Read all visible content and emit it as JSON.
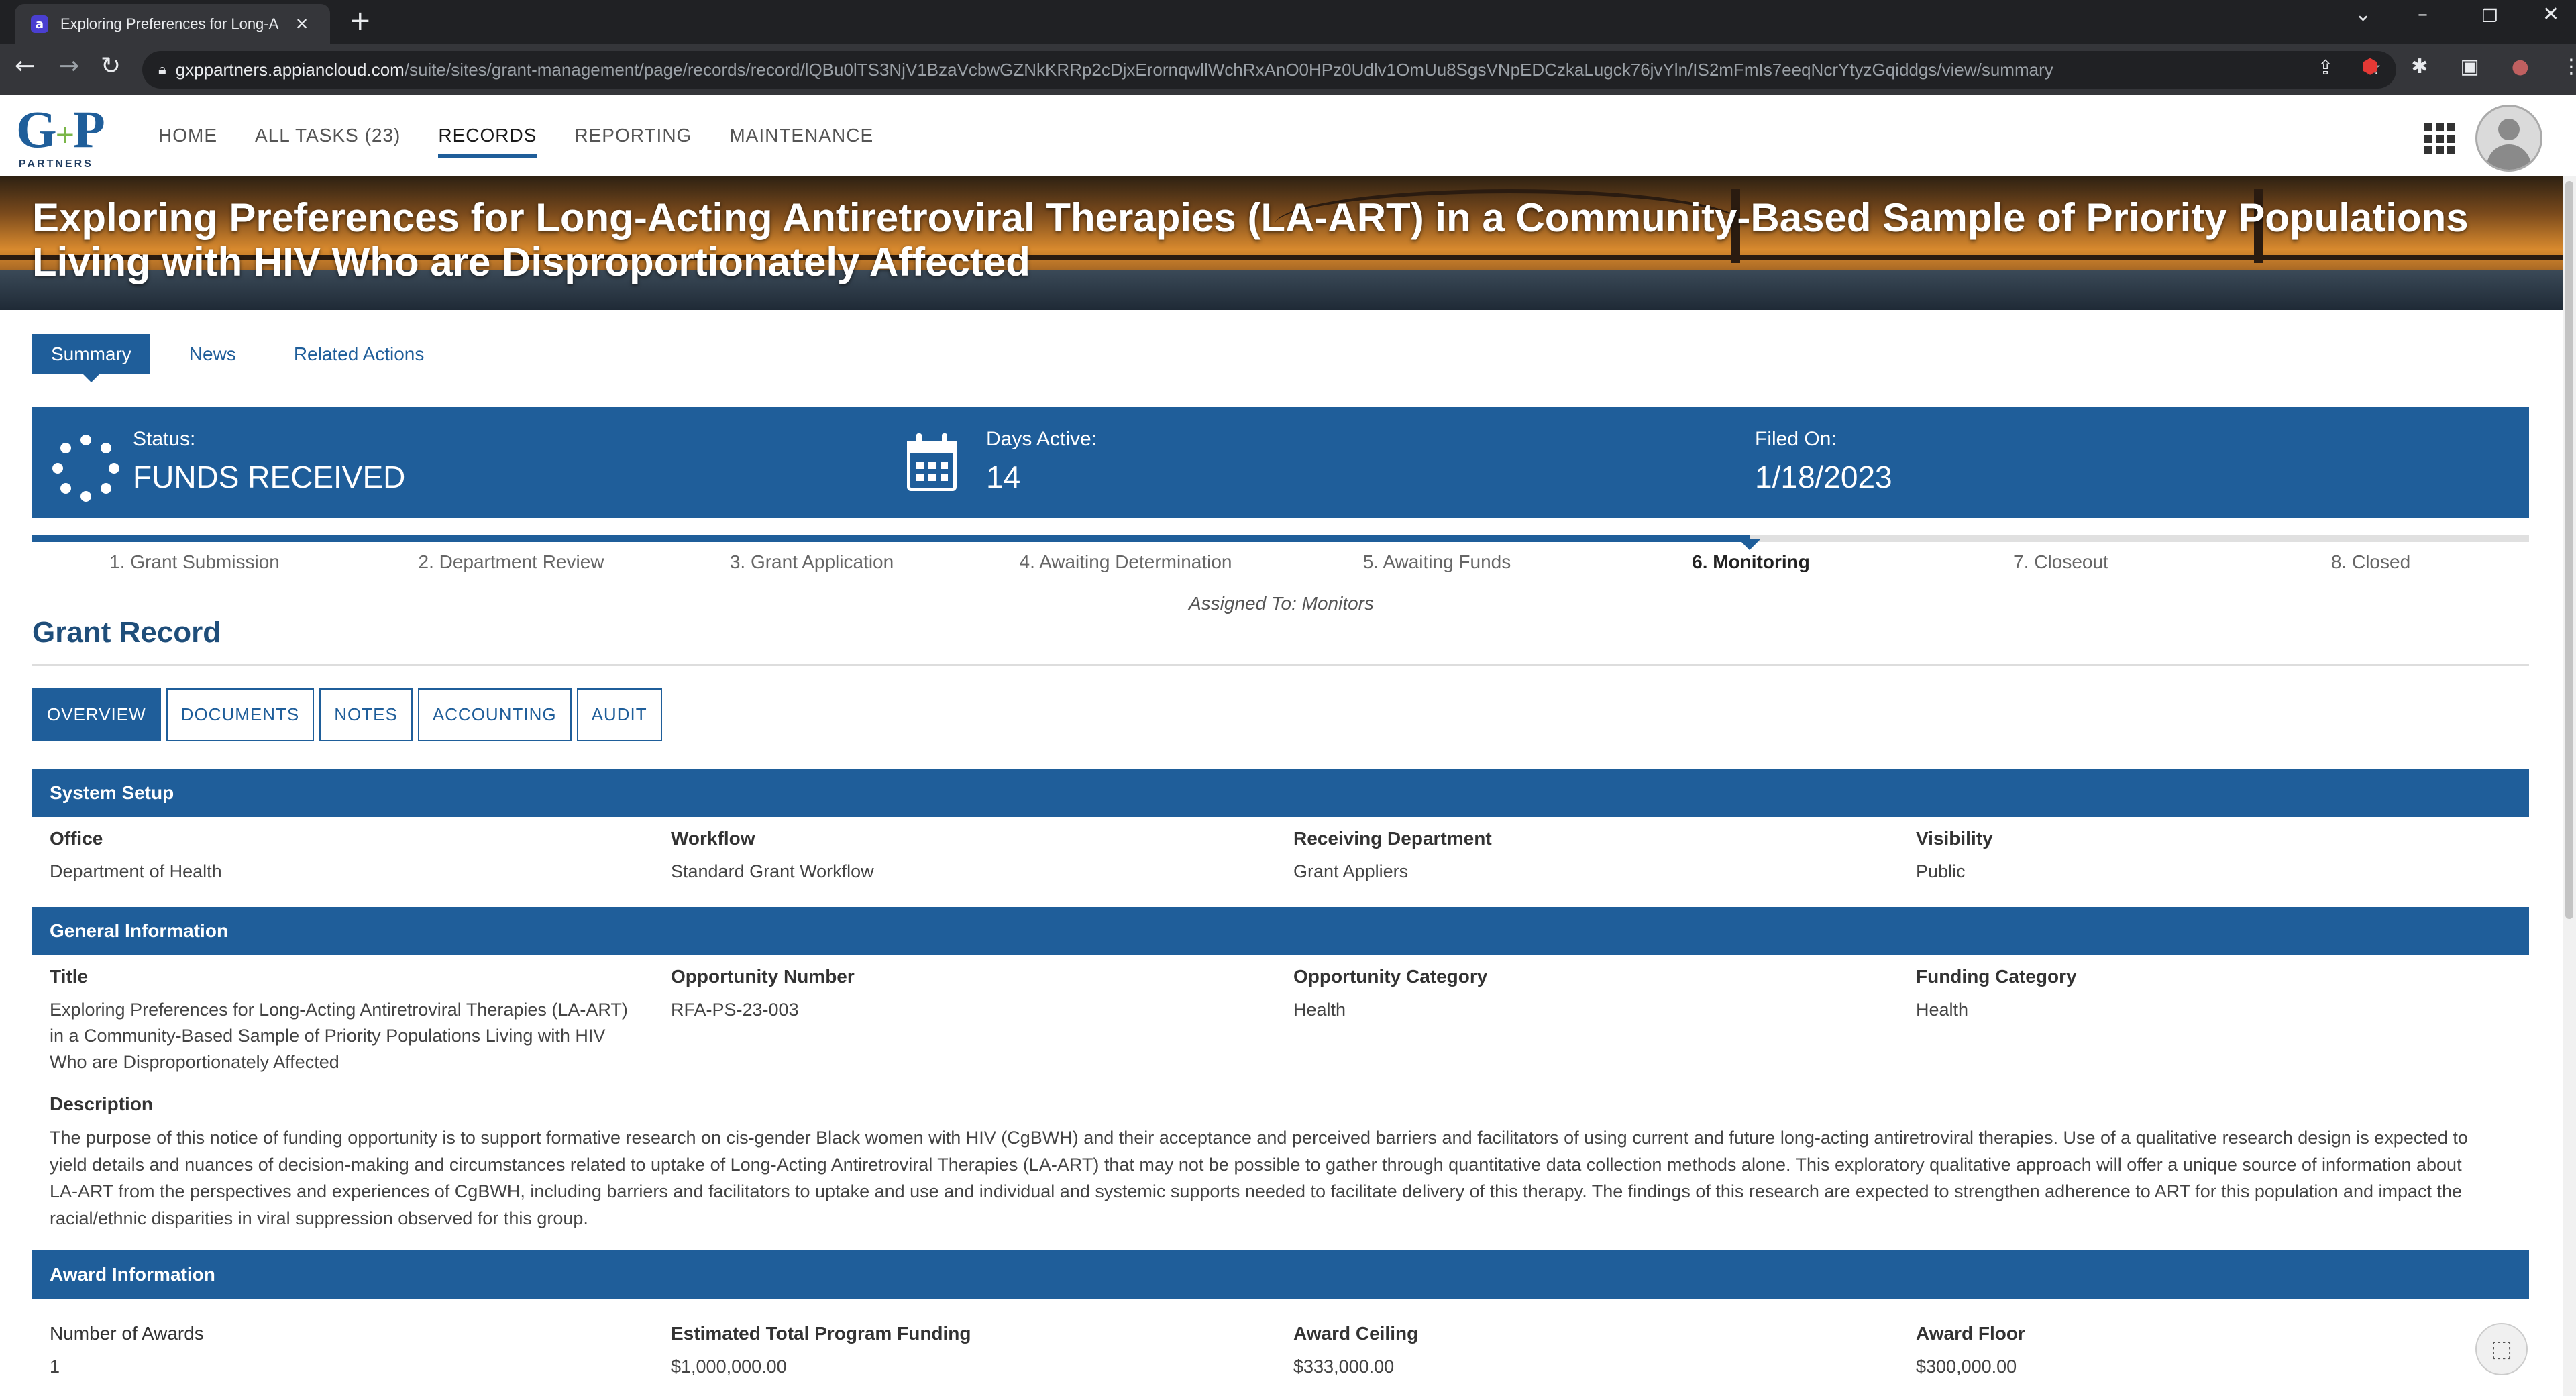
{
  "browser": {
    "tab_title": "Exploring Preferences for Long-A",
    "tab_favicon": "a",
    "url_host": "gxppartners.appiancloud.com",
    "url_path": "/suite/sites/grant-management/page/records/record/lQBu0lTS3NjV1BzaVcbwGZNkKRRp2cDjxErornqwllWchRxAnO0HPz0Udlv1OmUu8SgsVNpEDCzkaLugck76jvYln/IS2mFmIs7eeqNcrYtyzGqiddgs/view/summary"
  },
  "app": {
    "logo_main": "G",
    "logo_amp": "+",
    "logo_main2": "P",
    "logo_sub": "PARTNERS",
    "nav": [
      {
        "label": "HOME"
      },
      {
        "label": "ALL TASKS (23)"
      },
      {
        "label": "RECORDS"
      },
      {
        "label": "REPORTING"
      },
      {
        "label": "MAINTENANCE"
      }
    ]
  },
  "banner": {
    "title": "Exploring Preferences for Long-Acting Antiretroviral Therapies (LA-ART) in a Community-Based Sample of Priority Populations Living with HIV Who are Disproportionately Affected"
  },
  "subtabs": [
    {
      "label": "Summary"
    },
    {
      "label": "News"
    },
    {
      "label": "Related Actions"
    }
  ],
  "status": {
    "status_label": "Status:",
    "status_value": "FUNDS RECEIVED",
    "days_label": "Days Active:",
    "days_value": "14",
    "filed_label": "Filed On:",
    "filed_value": "1/18/2023"
  },
  "milestones": {
    "steps": [
      "1. Grant Submission",
      "2. Department Review",
      "3. Grant Application",
      "4. Awaiting Determination",
      "5. Awaiting Funds",
      "6. Monitoring",
      "7. Closeout",
      "8. Closed"
    ],
    "current_index": 5,
    "assigned": "Assigned To: Monitors"
  },
  "record": {
    "title": "Grant Record",
    "tabs": [
      {
        "label": "OVERVIEW"
      },
      {
        "label": "DOCUMENTS"
      },
      {
        "label": "NOTES"
      },
      {
        "label": "ACCOUNTING"
      },
      {
        "label": "AUDIT"
      }
    ]
  },
  "system_setup": {
    "heading": "System Setup",
    "office_label": "Office",
    "office_value": "Department of Health",
    "workflow_label": "Workflow",
    "workflow_value": "Standard Grant Workflow",
    "dept_label": "Receiving Department",
    "dept_value": "Grant Appliers",
    "visibility_label": "Visibility",
    "visibility_value": "Public"
  },
  "general": {
    "heading": "General Information",
    "title_label": "Title",
    "title_value": "Exploring Preferences for Long-Acting Antiretroviral Therapies (LA-ART) in a Community-Based Sample of Priority Populations Living with HIV Who are Disproportionately Affected",
    "opp_number_label": "Opportunity Number",
    "opp_number_value": "RFA-PS-23-003",
    "opp_category_label": "Opportunity Category",
    "opp_category_value": "Health",
    "funding_label": "Funding Category",
    "funding_value": "Health",
    "description_label": "Description",
    "description_value": "The purpose of this notice of funding opportunity is to support formative research on cis-gender Black women with HIV (CgBWH) and their acceptance and perceived barriers and facilitators of using current and future long-acting antiretroviral therapies. Use of a qualitative research design is expected to yield details and nuances of decision-making and circumstances related to uptake of Long-Acting Antiretroviral Therapies (LA-ART) that may not be possible to gather through quantitative data collection methods alone. This exploratory qualitative approach will offer a unique source of information about LA-ART from the perspectives and experiences of CgBWH, including barriers and facilitators to uptake and use and individual and systemic supports needed to facilitate delivery of this therapy. The findings of this research are expected to strengthen adherence to ART for this population and impact the racial/ethnic disparities in viral suppression observed for this group."
  },
  "award": {
    "heading": "Award Information",
    "num_label": "Number of Awards",
    "num_value": "1",
    "funding_label": "Estimated Total Program Funding",
    "funding_value": "$1,000,000.00",
    "ceiling_label": "Award Ceiling",
    "ceiling_value": "$333,000.00",
    "floor_label": "Award Floor",
    "floor_value": "$300,000.00"
  },
  "colors": {
    "primary": "#1f5e9a",
    "logo_green": "#7ab648"
  }
}
